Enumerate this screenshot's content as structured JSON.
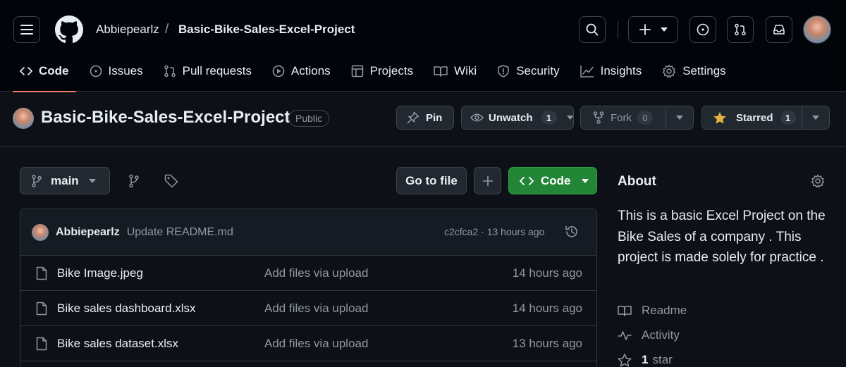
{
  "header": {
    "owner": "Abbiepearlz",
    "separator": "/",
    "repo": "Basic-Bike-Sales-Excel-Project"
  },
  "nav": {
    "code": "Code",
    "issues": "Issues",
    "pulls": "Pull requests",
    "actions": "Actions",
    "projects": "Projects",
    "wiki": "Wiki",
    "security": "Security",
    "insights": "Insights",
    "settings": "Settings"
  },
  "repo": {
    "title": "Basic-Bike-Sales-Excel-Project",
    "visibility": "Public",
    "pin_label": "Pin",
    "unwatch_label": "Unwatch",
    "watch_count": "1",
    "fork_label": "Fork",
    "fork_count": "0",
    "starred_label": "Starred",
    "star_count": "1"
  },
  "toolbar": {
    "branch": "main",
    "goto_file": "Go to file",
    "code_label": "Code"
  },
  "commit": {
    "author": "Abbiepearlz",
    "message": "Update README.md",
    "meta": "c2cfca2 · 13 hours ago"
  },
  "files": [
    {
      "name": "Bike Image.jpeg",
      "message": "Add files via upload",
      "time": "14 hours ago"
    },
    {
      "name": "Bike sales dashboard.xlsx",
      "message": "Add files via upload",
      "time": "14 hours ago"
    },
    {
      "name": "Bike sales dataset.xlsx",
      "message": "Add files via upload",
      "time": "13 hours ago"
    }
  ],
  "about": {
    "title": "About",
    "description": "This is a basic Excel Project on the Bike Sales of a company . This project is made solely for practice .",
    "readme": "Readme",
    "activity": "Activity",
    "stars_count": "1",
    "stars_label": "star"
  },
  "colors": {
    "background": "#0d1117",
    "header_bg": "#010409",
    "accent_underline": "#f78166",
    "code_button": "#238636",
    "star_icon": "#e3b341"
  }
}
